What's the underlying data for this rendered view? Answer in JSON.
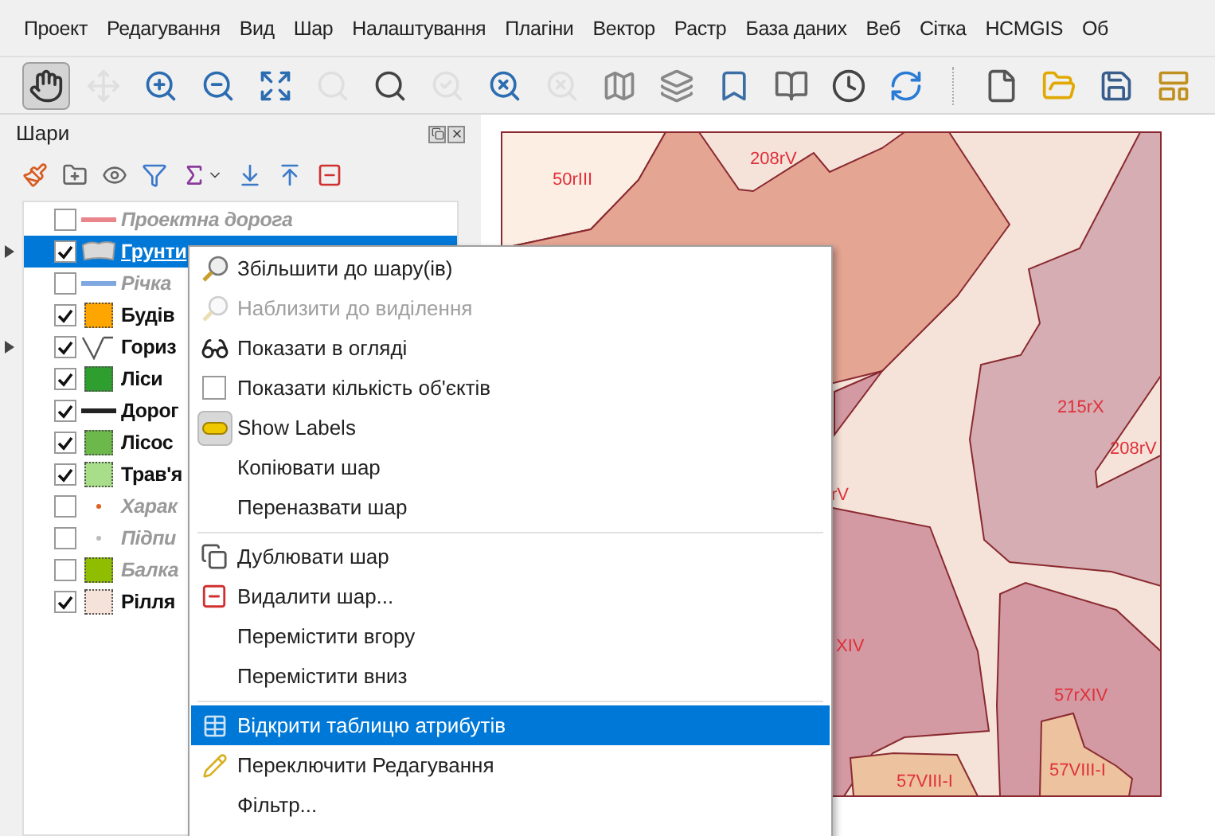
{
  "menubar": [
    "Проект",
    "Редагування",
    "Вид",
    "Шар",
    "Налаштування",
    "Плагіни",
    "Вектор",
    "Растр",
    "База даних",
    "Веб",
    "Сітка",
    "HCMGIS",
    "Об"
  ],
  "toolbar": [
    {
      "kind": "button",
      "disabled": false,
      "selected": true
    },
    {
      "kind": "button",
      "disabled": true,
      "selected": false
    },
    {
      "kind": "button",
      "disabled": false,
      "selected": false
    },
    {
      "kind": "button",
      "disabled": false,
      "selected": false
    },
    {
      "kind": "button",
      "disabled": false,
      "selected": false
    },
    {
      "kind": "button",
      "disabled": true,
      "selected": false
    },
    {
      "kind": "button",
      "disabled": false,
      "selected": false
    },
    {
      "kind": "button",
      "disabled": true,
      "selected": false
    },
    {
      "kind": "button",
      "disabled": false,
      "selected": false
    },
    {
      "kind": "button",
      "disabled": true,
      "selected": false
    },
    {
      "kind": "button",
      "disabled": false,
      "selected": false
    },
    {
      "kind": "button",
      "disabled": false,
      "selected": false
    },
    {
      "kind": "button",
      "disabled": false,
      "selected": false
    },
    {
      "kind": "button",
      "disabled": false,
      "selected": false
    },
    {
      "kind": "button",
      "disabled": false,
      "selected": false
    },
    {
      "kind": "button",
      "disabled": false,
      "selected": false
    },
    {
      "kind": "separator"
    },
    {
      "kind": "button",
      "disabled": false,
      "selected": false
    },
    {
      "kind": "button",
      "disabled": false,
      "selected": false
    },
    {
      "kind": "button",
      "disabled": false,
      "selected": false
    },
    {
      "kind": "button",
      "disabled": false,
      "selected": false
    }
  ],
  "layers_panel": {
    "title": "Шари",
    "layers": [
      {
        "name": "Проектна дорога",
        "checked": false,
        "selected": false,
        "collapsed": false,
        "symbol": {
          "kind": "line",
          "color": "#e8868c"
        }
      },
      {
        "name": "Грунти",
        "checked": true,
        "selected": true,
        "collapsed": true,
        "symbol": {
          "kind": "shape",
          "color": "#d9d9d9"
        }
      },
      {
        "name": "Річка",
        "checked": false,
        "selected": false,
        "collapsed": false,
        "symbol": {
          "kind": "line",
          "color": "#7fa7e0"
        }
      },
      {
        "name": "Будів",
        "checked": true,
        "selected": false,
        "collapsed": false,
        "symbol": {
          "kind": "fill",
          "color": "#ffa500"
        }
      },
      {
        "name": "Гориз",
        "checked": true,
        "selected": false,
        "collapsed": true,
        "symbol": {
          "kind": "contour",
          "color": "#555555"
        }
      },
      {
        "name": "Ліси",
        "checked": true,
        "selected": false,
        "collapsed": false,
        "symbol": {
          "kind": "fill",
          "color": "#2e9e2e"
        }
      },
      {
        "name": "Дорог",
        "checked": true,
        "selected": false,
        "collapsed": false,
        "symbol": {
          "kind": "line",
          "color": "#222222"
        }
      },
      {
        "name": "Лісос",
        "checked": true,
        "selected": false,
        "collapsed": false,
        "symbol": {
          "kind": "fill",
          "color": "#6cb84a"
        }
      },
      {
        "name": "Трав'я",
        "checked": true,
        "selected": false,
        "collapsed": false,
        "symbol": {
          "kind": "fill",
          "color": "#a8dd8a"
        }
      },
      {
        "name": "Харак",
        "checked": false,
        "selected": false,
        "collapsed": false,
        "symbol": {
          "kind": "dot",
          "color": "#e06020"
        }
      },
      {
        "name": "Підпи",
        "checked": false,
        "selected": false,
        "collapsed": false,
        "symbol": {
          "kind": "dot",
          "color": "#bbbbbb"
        }
      },
      {
        "name": "Балка",
        "checked": false,
        "selected": false,
        "collapsed": false,
        "symbol": {
          "kind": "fill",
          "color": "#8fbe00"
        }
      },
      {
        "name": "Рілля",
        "checked": true,
        "selected": false,
        "collapsed": false,
        "symbol": {
          "kind": "fill",
          "color": "#f5e3da"
        }
      }
    ]
  },
  "context_menu": [
    {
      "kind": "item",
      "label": "Збільшити до шару(ів)",
      "disabled": false,
      "selected": false
    },
    {
      "kind": "item",
      "label": "Наблизити до виділення",
      "disabled": true,
      "selected": false
    },
    {
      "kind": "item",
      "label": "Показати в огляді",
      "disabled": false,
      "selected": false
    },
    {
      "kind": "item",
      "label": "Показати кількість об'єктів",
      "disabled": false,
      "selected": false
    },
    {
      "kind": "item",
      "label": "Show Labels",
      "disabled": false,
      "selected": false
    },
    {
      "kind": "item",
      "label": "Копіювати шар",
      "disabled": false,
      "selected": false
    },
    {
      "kind": "item",
      "label": "Переназвати шар",
      "disabled": false,
      "selected": false
    },
    {
      "kind": "separator"
    },
    {
      "kind": "item",
      "label": "Дублювати шар",
      "disabled": false,
      "selected": false
    },
    {
      "kind": "item",
      "label": "Видалити шар...",
      "disabled": false,
      "selected": false
    },
    {
      "kind": "item",
      "label": "Перемістити вгору",
      "disabled": false,
      "selected": false
    },
    {
      "kind": "item",
      "label": "Перемістити вниз",
      "disabled": false,
      "selected": false
    },
    {
      "kind": "separator"
    },
    {
      "kind": "item",
      "label": "Відкрити таблицю атрибутів",
      "disabled": false,
      "selected": true
    },
    {
      "kind": "item",
      "label": "Переключити Редагування",
      "disabled": false,
      "selected": false
    },
    {
      "kind": "item",
      "label": "Фільтр...",
      "disabled": false,
      "selected": false
    }
  ],
  "map_labels": [
    "50rIII",
    "208rV",
    "215rX",
    "208rV",
    "rV",
    "XIV",
    "57rXIV",
    "57VIII-I",
    "57VIII-I"
  ]
}
